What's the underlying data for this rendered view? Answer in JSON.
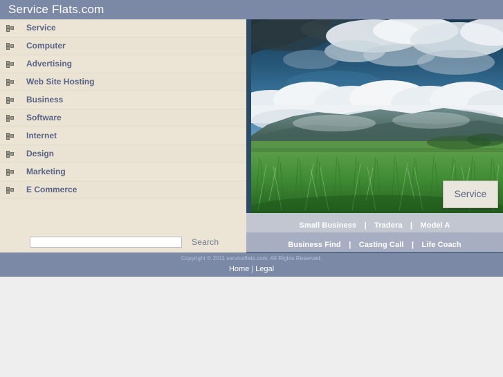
{
  "header": {
    "title": "Service Flats.com",
    "background": "#7b88a6",
    "text_color": "#ffffff"
  },
  "sidebar": {
    "background": "#ece5d6",
    "link_color": "#5a6384",
    "bullet_icon": "three-squares-icon",
    "items": [
      {
        "label": "Service"
      },
      {
        "label": "Computer"
      },
      {
        "label": "Advertising"
      },
      {
        "label": "Web Site Hosting"
      },
      {
        "label": "Business"
      },
      {
        "label": "Software"
      },
      {
        "label": "Internet"
      },
      {
        "label": "Design"
      },
      {
        "label": "Marketing"
      },
      {
        "label": "E Commerce"
      }
    ]
  },
  "search": {
    "value": "",
    "placeholder": "",
    "button_label": "Search"
  },
  "hero": {
    "caption": "Service",
    "alt": "sugarcane field with mountains and clouds",
    "sky_color": "#3c6c94",
    "cloud_color": "#f2f4f6",
    "field_color": "#3f8b34",
    "mountain_color": "#4e6b63"
  },
  "link_rows": [
    {
      "background": "#c2c6d1",
      "links": [
        "Small Business",
        "Tradera",
        "Model A"
      ],
      "separator": "|"
    },
    {
      "background": "#a8aec2",
      "links": [
        "Business Find",
        "Casting Call",
        "Life Coach"
      ],
      "separator": "|"
    }
  ],
  "footer": {
    "background": "#7b88a6",
    "copyright": "Copyright © 2011 serviceflats.com. All Rights Reserved.",
    "links": [
      "Home",
      "Legal"
    ],
    "separator": "|"
  }
}
